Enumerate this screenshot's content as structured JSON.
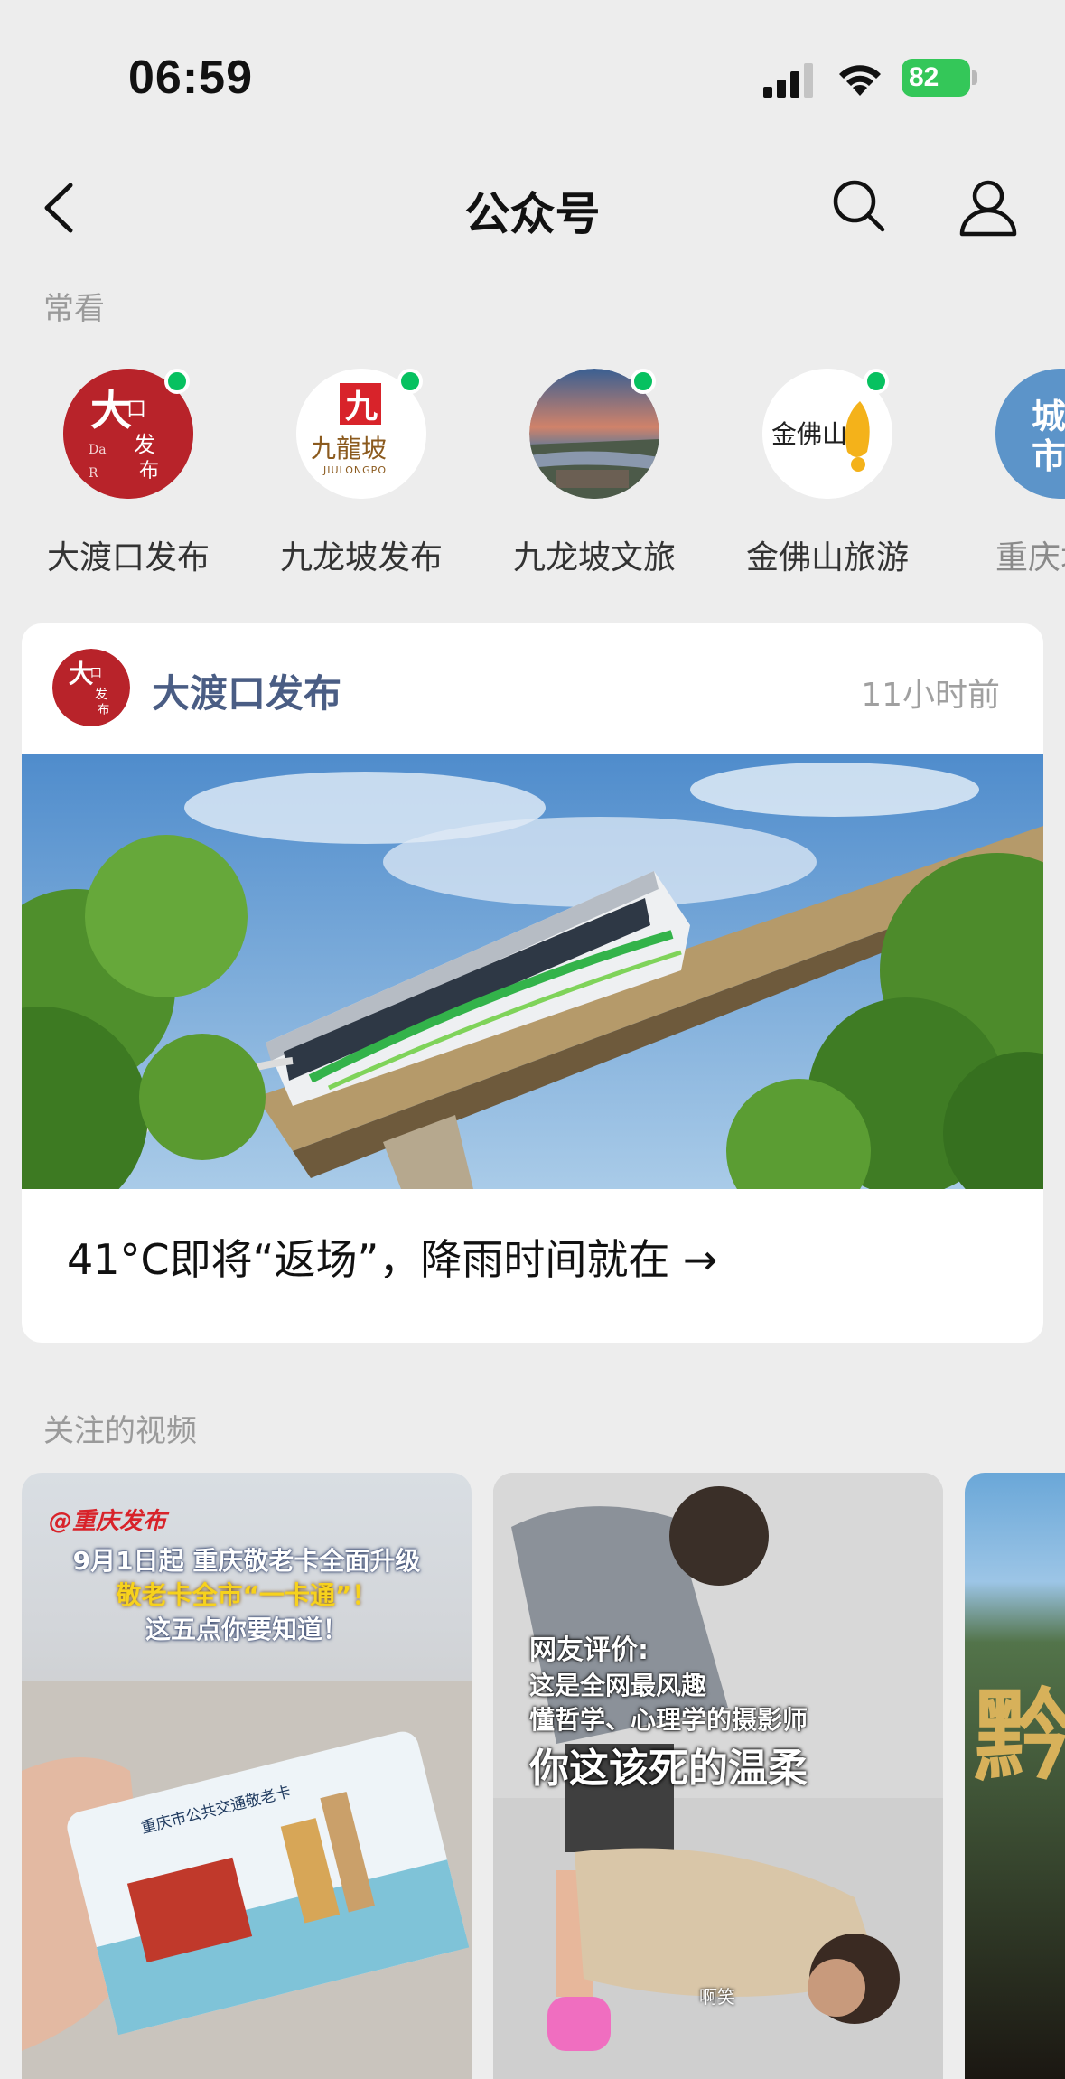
{
  "status_bar": {
    "time": "06:59",
    "battery": "82"
  },
  "nav": {
    "title": "公众号"
  },
  "frequent": {
    "label": "常看",
    "items": [
      {
        "name": "大渡口发布",
        "avatar_text": "大渡口发布"
      },
      {
        "name": "九龙坡发布",
        "avatar_text": "九龍坡",
        "avatar_sub": "JIULONGPO"
      },
      {
        "name": "九龙坡文旅"
      },
      {
        "name": "金佛山旅游",
        "avatar_text": "金佛山"
      },
      {
        "name": "重庆城市",
        "avatar_text": "城市"
      }
    ]
  },
  "article": {
    "account": "大渡口发布",
    "time": "11小时前",
    "headline": "41°C即将“返场”，降雨时间就在 →"
  },
  "videos": {
    "label": "关注的视频",
    "items": [
      {
        "source_tag": "@重庆发布",
        "line1": "9月1日起 重庆敬老卡全面升级",
        "line2": "敬老卡全市“一卡通”！",
        "line3": "这五点你要知道！",
        "card_label": "重庆市公共交通敬老卡"
      },
      {
        "line1": "网友评价:",
        "line2": "这是全网最风趣",
        "line3": "懂哲学、心理学的摄影师",
        "line4": "你这该死的温柔",
        "caption": "啊笑"
      },
      {
        "big_text": "黔"
      }
    ]
  }
}
